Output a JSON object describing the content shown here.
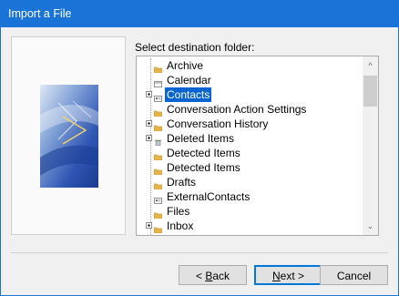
{
  "window": {
    "title": "Import a File",
    "accent": "#1a73d6"
  },
  "prompt": "Select destination folder:",
  "tree": {
    "items": [
      {
        "label": "Archive",
        "icon": "folder-icon",
        "expandable": false,
        "selected": false
      },
      {
        "label": "Calendar",
        "icon": "calendar-icon",
        "expandable": false,
        "selected": false
      },
      {
        "label": "Contacts",
        "icon": "contacts-icon",
        "expandable": true,
        "selected": true
      },
      {
        "label": "Conversation Action Settings",
        "icon": "folder-icon",
        "expandable": false,
        "selected": false
      },
      {
        "label": "Conversation History",
        "icon": "folder-icon",
        "expandable": true,
        "selected": false
      },
      {
        "label": "Deleted Items",
        "icon": "trash-icon",
        "expandable": true,
        "selected": false
      },
      {
        "label": "Detected Items",
        "icon": "folder-icon",
        "expandable": false,
        "selected": false
      },
      {
        "label": "Detected Items",
        "icon": "folder-icon",
        "expandable": false,
        "selected": false
      },
      {
        "label": "Drafts",
        "icon": "folder-icon",
        "expandable": false,
        "selected": false
      },
      {
        "label": "ExternalContacts",
        "icon": "contacts-icon",
        "expandable": false,
        "selected": false
      },
      {
        "label": "Files",
        "icon": "folder-icon",
        "expandable": false,
        "selected": false
      },
      {
        "label": "Inbox",
        "icon": "folder-icon",
        "expandable": true,
        "selected": false
      }
    ]
  },
  "buttons": {
    "back_prefix": "< ",
    "back_accel": "B",
    "back_rest": "ack",
    "next_accel": "N",
    "next_rest": "ext >",
    "cancel": "Cancel"
  },
  "colors": {
    "selection": "#0a64d2",
    "default_button_border": "#0078d7"
  }
}
